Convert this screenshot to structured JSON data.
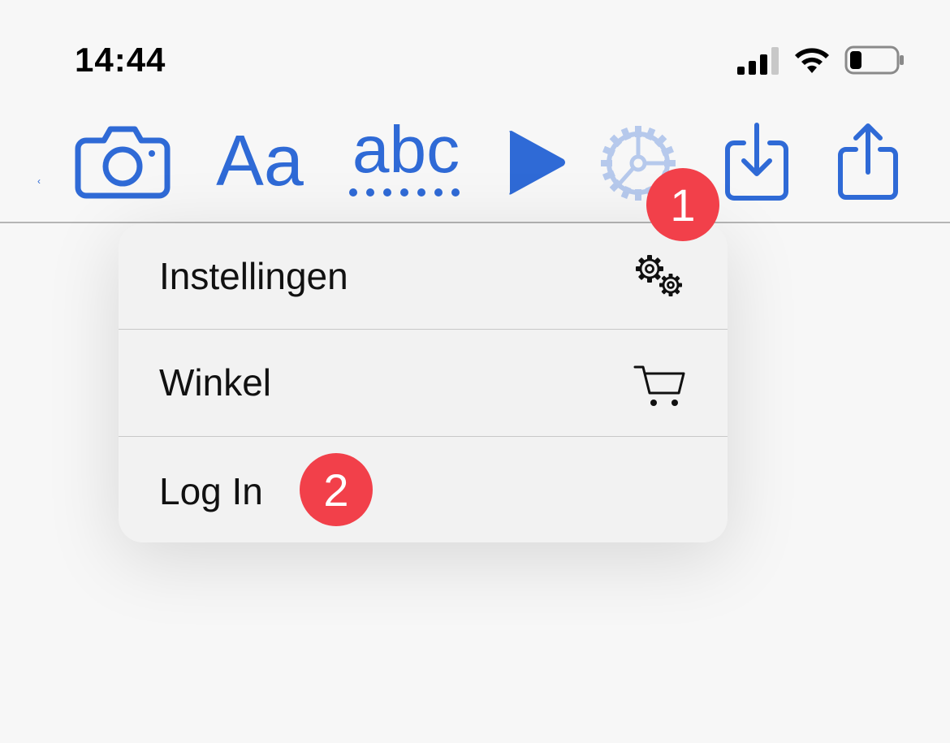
{
  "status_bar": {
    "time": "14:44",
    "signal_icon": "cellular-signal-icon",
    "wifi_icon": "wifi-icon",
    "battery_icon": "battery-icon",
    "battery_level": 0.25
  },
  "toolbar": {
    "items": [
      {
        "name": "camera-button",
        "icon": "camera-icon"
      },
      {
        "name": "text-size-button",
        "label": "Aa"
      },
      {
        "name": "spellcheck-button",
        "label": "abc"
      },
      {
        "name": "play-button",
        "icon": "play-icon"
      },
      {
        "name": "settings-button",
        "icon": "gear-icon"
      },
      {
        "name": "download-button",
        "icon": "download-icon"
      },
      {
        "name": "share-button",
        "icon": "share-icon"
      }
    ],
    "back_chevron": "‹"
  },
  "menu": {
    "items": [
      {
        "label": "Instellingen",
        "icon": "gears-icon"
      },
      {
        "label": "Winkel",
        "icon": "cart-icon"
      },
      {
        "label": "Log In"
      }
    ]
  },
  "badges": [
    "1",
    "2"
  ],
  "colors": {
    "accent": "#2f6ad6",
    "badge": "#f2404a",
    "menu_bg": "#f2f2f2"
  }
}
